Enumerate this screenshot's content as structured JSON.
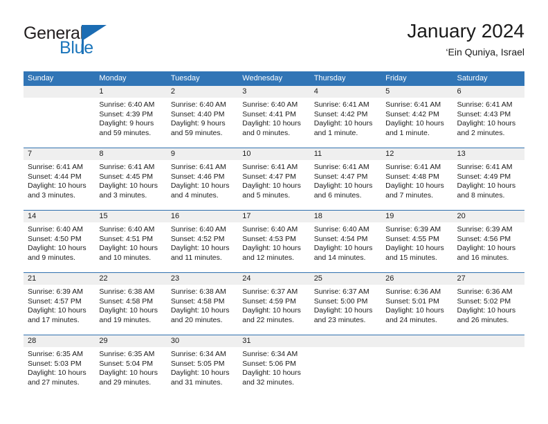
{
  "brand": {
    "name_part1": "General",
    "name_part2": "Blue",
    "logo_icon": "triangle-flag-icon",
    "accent_color": "#1b75bb"
  },
  "header": {
    "title": "January 2024",
    "subtitle": "‘Ein Quniya, Israel"
  },
  "theme": {
    "header_blue": "#3175b6",
    "week_divider_blue": "#2e6fae",
    "date_strip_gray": "#efefef",
    "text_color": "#1a1a1a"
  },
  "calendar": {
    "day_headers": [
      "Sunday",
      "Monday",
      "Tuesday",
      "Wednesday",
      "Thursday",
      "Friday",
      "Saturday"
    ],
    "weeks": [
      [
        {
          "day": "",
          "lines": []
        },
        {
          "day": "1",
          "lines": [
            "Sunrise: 6:40 AM",
            "Sunset: 4:39 PM",
            "Daylight: 9 hours",
            "and 59 minutes."
          ]
        },
        {
          "day": "2",
          "lines": [
            "Sunrise: 6:40 AM",
            "Sunset: 4:40 PM",
            "Daylight: 9 hours",
            "and 59 minutes."
          ]
        },
        {
          "day": "3",
          "lines": [
            "Sunrise: 6:40 AM",
            "Sunset: 4:41 PM",
            "Daylight: 10 hours",
            "and 0 minutes."
          ]
        },
        {
          "day": "4",
          "lines": [
            "Sunrise: 6:41 AM",
            "Sunset: 4:42 PM",
            "Daylight: 10 hours",
            "and 1 minute."
          ]
        },
        {
          "day": "5",
          "lines": [
            "Sunrise: 6:41 AM",
            "Sunset: 4:42 PM",
            "Daylight: 10 hours",
            "and 1 minute."
          ]
        },
        {
          "day": "6",
          "lines": [
            "Sunrise: 6:41 AM",
            "Sunset: 4:43 PM",
            "Daylight: 10 hours",
            "and 2 minutes."
          ]
        }
      ],
      [
        {
          "day": "7",
          "lines": [
            "Sunrise: 6:41 AM",
            "Sunset: 4:44 PM",
            "Daylight: 10 hours",
            "and 3 minutes."
          ]
        },
        {
          "day": "8",
          "lines": [
            "Sunrise: 6:41 AM",
            "Sunset: 4:45 PM",
            "Daylight: 10 hours",
            "and 3 minutes."
          ]
        },
        {
          "day": "9",
          "lines": [
            "Sunrise: 6:41 AM",
            "Sunset: 4:46 PM",
            "Daylight: 10 hours",
            "and 4 minutes."
          ]
        },
        {
          "day": "10",
          "lines": [
            "Sunrise: 6:41 AM",
            "Sunset: 4:47 PM",
            "Daylight: 10 hours",
            "and 5 minutes."
          ]
        },
        {
          "day": "11",
          "lines": [
            "Sunrise: 6:41 AM",
            "Sunset: 4:47 PM",
            "Daylight: 10 hours",
            "and 6 minutes."
          ]
        },
        {
          "day": "12",
          "lines": [
            "Sunrise: 6:41 AM",
            "Sunset: 4:48 PM",
            "Daylight: 10 hours",
            "and 7 minutes."
          ]
        },
        {
          "day": "13",
          "lines": [
            "Sunrise: 6:41 AM",
            "Sunset: 4:49 PM",
            "Daylight: 10 hours",
            "and 8 minutes."
          ]
        }
      ],
      [
        {
          "day": "14",
          "lines": [
            "Sunrise: 6:40 AM",
            "Sunset: 4:50 PM",
            "Daylight: 10 hours",
            "and 9 minutes."
          ]
        },
        {
          "day": "15",
          "lines": [
            "Sunrise: 6:40 AM",
            "Sunset: 4:51 PM",
            "Daylight: 10 hours",
            "and 10 minutes."
          ]
        },
        {
          "day": "16",
          "lines": [
            "Sunrise: 6:40 AM",
            "Sunset: 4:52 PM",
            "Daylight: 10 hours",
            "and 11 minutes."
          ]
        },
        {
          "day": "17",
          "lines": [
            "Sunrise: 6:40 AM",
            "Sunset: 4:53 PM",
            "Daylight: 10 hours",
            "and 12 minutes."
          ]
        },
        {
          "day": "18",
          "lines": [
            "Sunrise: 6:40 AM",
            "Sunset: 4:54 PM",
            "Daylight: 10 hours",
            "and 14 minutes."
          ]
        },
        {
          "day": "19",
          "lines": [
            "Sunrise: 6:39 AM",
            "Sunset: 4:55 PM",
            "Daylight: 10 hours",
            "and 15 minutes."
          ]
        },
        {
          "day": "20",
          "lines": [
            "Sunrise: 6:39 AM",
            "Sunset: 4:56 PM",
            "Daylight: 10 hours",
            "and 16 minutes."
          ]
        }
      ],
      [
        {
          "day": "21",
          "lines": [
            "Sunrise: 6:39 AM",
            "Sunset: 4:57 PM",
            "Daylight: 10 hours",
            "and 17 minutes."
          ]
        },
        {
          "day": "22",
          "lines": [
            "Sunrise: 6:38 AM",
            "Sunset: 4:58 PM",
            "Daylight: 10 hours",
            "and 19 minutes."
          ]
        },
        {
          "day": "23",
          "lines": [
            "Sunrise: 6:38 AM",
            "Sunset: 4:58 PM",
            "Daylight: 10 hours",
            "and 20 minutes."
          ]
        },
        {
          "day": "24",
          "lines": [
            "Sunrise: 6:37 AM",
            "Sunset: 4:59 PM",
            "Daylight: 10 hours",
            "and 22 minutes."
          ]
        },
        {
          "day": "25",
          "lines": [
            "Sunrise: 6:37 AM",
            "Sunset: 5:00 PM",
            "Daylight: 10 hours",
            "and 23 minutes."
          ]
        },
        {
          "day": "26",
          "lines": [
            "Sunrise: 6:36 AM",
            "Sunset: 5:01 PM",
            "Daylight: 10 hours",
            "and 24 minutes."
          ]
        },
        {
          "day": "27",
          "lines": [
            "Sunrise: 6:36 AM",
            "Sunset: 5:02 PM",
            "Daylight: 10 hours",
            "and 26 minutes."
          ]
        }
      ],
      [
        {
          "day": "28",
          "lines": [
            "Sunrise: 6:35 AM",
            "Sunset: 5:03 PM",
            "Daylight: 10 hours",
            "and 27 minutes."
          ]
        },
        {
          "day": "29",
          "lines": [
            "Sunrise: 6:35 AM",
            "Sunset: 5:04 PM",
            "Daylight: 10 hours",
            "and 29 minutes."
          ]
        },
        {
          "day": "30",
          "lines": [
            "Sunrise: 6:34 AM",
            "Sunset: 5:05 PM",
            "Daylight: 10 hours",
            "and 31 minutes."
          ]
        },
        {
          "day": "31",
          "lines": [
            "Sunrise: 6:34 AM",
            "Sunset: 5:06 PM",
            "Daylight: 10 hours",
            "and 32 minutes."
          ]
        },
        {
          "day": "",
          "lines": []
        },
        {
          "day": "",
          "lines": []
        },
        {
          "day": "",
          "lines": []
        }
      ]
    ]
  }
}
